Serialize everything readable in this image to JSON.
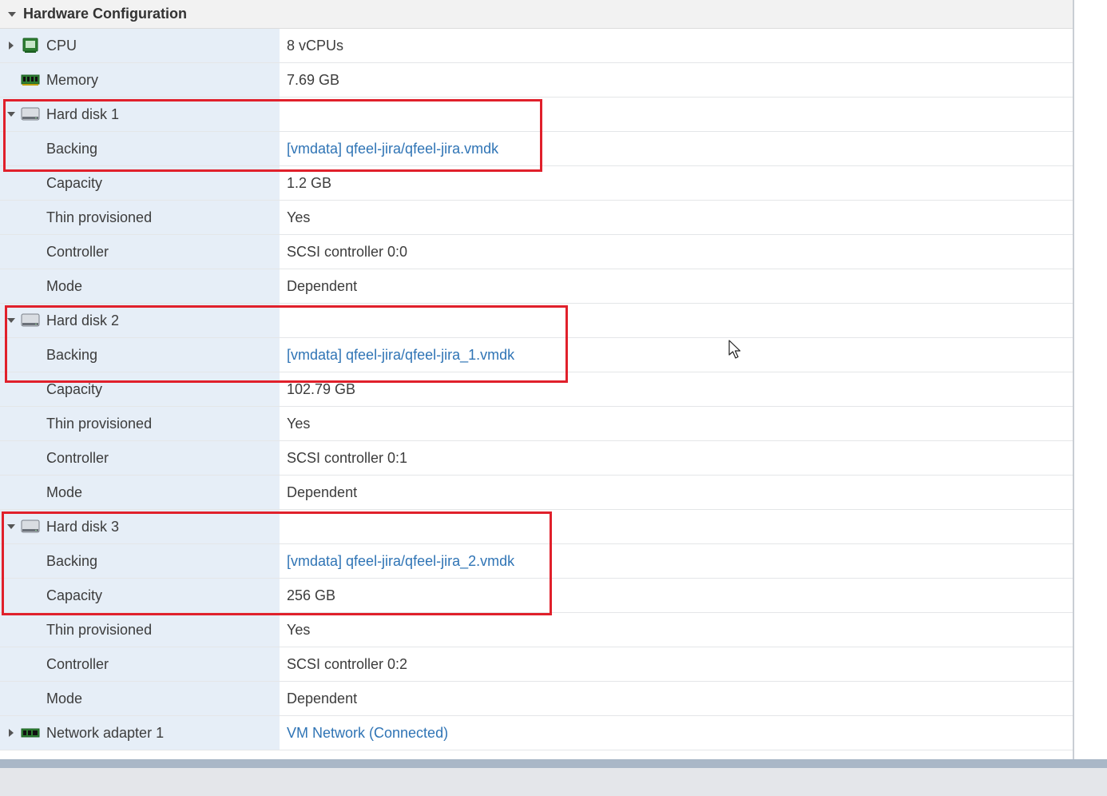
{
  "section": {
    "title": "Hardware Configuration"
  },
  "rows": [
    {
      "label": "CPU",
      "value": "8 vCPUs",
      "icon": "cpu-icon",
      "toggle": "collapsed",
      "indent": false,
      "link": false
    },
    {
      "label": "Memory",
      "value": "7.69 GB",
      "icon": "memory-icon",
      "toggle": "none",
      "indent": false,
      "link": false
    },
    {
      "label": "Hard disk 1",
      "value": "",
      "icon": "hard-disk-icon",
      "toggle": "expanded",
      "indent": false,
      "link": false
    },
    {
      "label": "Backing",
      "value": "[vmdata] qfeel-jira/qfeel-jira.vmdk",
      "indent": true,
      "link": true
    },
    {
      "label": "Capacity",
      "value": "1.2 GB",
      "indent": true,
      "link": false
    },
    {
      "label": "Thin provisioned",
      "value": "Yes",
      "indent": true,
      "link": false
    },
    {
      "label": "Controller",
      "value": "SCSI controller 0:0",
      "indent": true,
      "link": false
    },
    {
      "label": "Mode",
      "value": "Dependent",
      "indent": true,
      "link": false
    },
    {
      "label": "Hard disk 2",
      "value": "",
      "icon": "hard-disk-icon",
      "toggle": "expanded",
      "indent": false,
      "link": false
    },
    {
      "label": "Backing",
      "value": "[vmdata] qfeel-jira/qfeel-jira_1.vmdk",
      "indent": true,
      "link": true
    },
    {
      "label": "Capacity",
      "value": "102.79 GB",
      "indent": true,
      "link": false
    },
    {
      "label": "Thin provisioned",
      "value": "Yes",
      "indent": true,
      "link": false
    },
    {
      "label": "Controller",
      "value": "SCSI controller 0:1",
      "indent": true,
      "link": false
    },
    {
      "label": "Mode",
      "value": "Dependent",
      "indent": true,
      "link": false
    },
    {
      "label": "Hard disk 3",
      "value": "",
      "icon": "hard-disk-icon",
      "toggle": "expanded",
      "indent": false,
      "link": false
    },
    {
      "label": "Backing",
      "value": "[vmdata] qfeel-jira/qfeel-jira_2.vmdk",
      "indent": true,
      "link": true
    },
    {
      "label": "Capacity",
      "value": "256 GB",
      "indent": true,
      "link": false
    },
    {
      "label": "Thin provisioned",
      "value": "Yes",
      "indent": true,
      "link": false
    },
    {
      "label": "Controller",
      "value": "SCSI controller 0:2",
      "indent": true,
      "link": false
    },
    {
      "label": "Mode",
      "value": "Dependent",
      "indent": true,
      "link": false
    },
    {
      "label": "Network adapter 1",
      "value": "VM Network (Connected)",
      "icon": "network-adapter-icon",
      "toggle": "collapsed",
      "indent": false,
      "link": true
    }
  ],
  "colors": {
    "label_bg": "#e6eef7",
    "link": "#2f74b5",
    "highlight_box": "#e0202b",
    "row_border": "#e4e6e8"
  }
}
